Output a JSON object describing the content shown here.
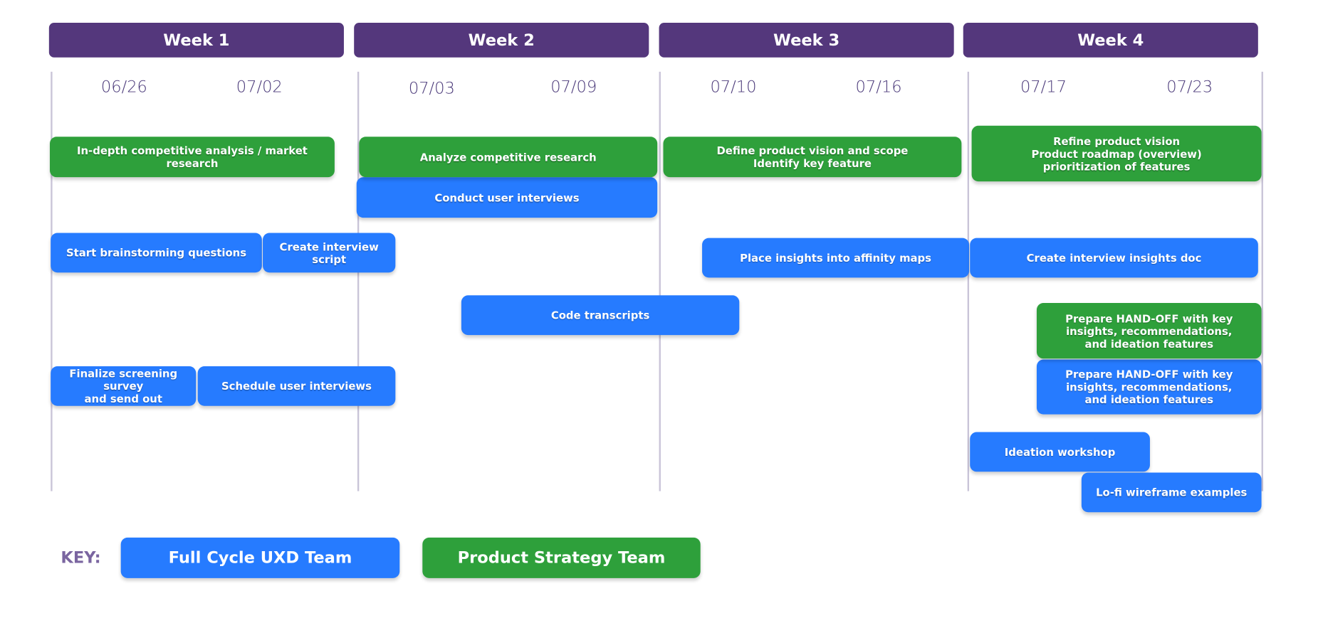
{
  "weeks": [
    {
      "label": "Week 1",
      "dates": [
        "06/26",
        "07/02"
      ]
    },
    {
      "label": "Week 2",
      "dates": [
        "07/03",
        "07/09"
      ]
    },
    {
      "label": "Week 3",
      "dates": [
        "07/10",
        "07/16"
      ]
    },
    {
      "label": "Week 4",
      "dates": [
        "07/17",
        "07/23"
      ]
    }
  ],
  "tasks": [
    {
      "label": "In-depth competitive analysis / market research",
      "team": "Product Strategy Team"
    },
    {
      "label": "Analyze competitive research",
      "team": "Product Strategy Team"
    },
    {
      "label": "Conduct user interviews",
      "team": "Full Cycle UXD Team"
    },
    {
      "label": "Define product vision and scope\nIdentify key feature",
      "team": "Product Strategy Team"
    },
    {
      "label": "Refine product vision\nProduct roadmap (overview)\nprioritization of features",
      "team": "Product Strategy Team"
    },
    {
      "label": "Start brainstorming questions",
      "team": "Full Cycle UXD Team"
    },
    {
      "label": "Create interview script",
      "team": "Full Cycle UXD Team"
    },
    {
      "label": "Place insights into affinity maps",
      "team": "Full Cycle UXD Team"
    },
    {
      "label": "Create interview insights doc",
      "team": "Full Cycle UXD Team"
    },
    {
      "label": "Code transcripts",
      "team": "Full Cycle UXD Team"
    },
    {
      "label": "Prepare HAND-OFF with key\ninsights, recommendations,\nand ideation features",
      "team": "Product Strategy Team"
    },
    {
      "label": "Prepare HAND-OFF with key\ninsights, recommendations,\nand ideation features",
      "team": "Full Cycle UXD Team"
    },
    {
      "label": "Finalize screening survey\nand send out",
      "team": "Full Cycle UXD Team"
    },
    {
      "label": "Schedule user interviews",
      "team": "Full Cycle UXD Team"
    },
    {
      "label": "Ideation workshop",
      "team": "Full Cycle UXD Team"
    },
    {
      "label": "Lo-fi wireframe examples",
      "team": "Full Cycle UXD Team"
    }
  ],
  "key": {
    "label": "KEY:",
    "items": [
      {
        "label": "Full Cycle UXD Team",
        "color": "#267bff"
      },
      {
        "label": "Product Strategy Team",
        "color": "#2ea03b"
      }
    ]
  },
  "colors": {
    "week_header": "#54377c",
    "ux_team": "#267bff",
    "strategy_team": "#2ea03b"
  }
}
